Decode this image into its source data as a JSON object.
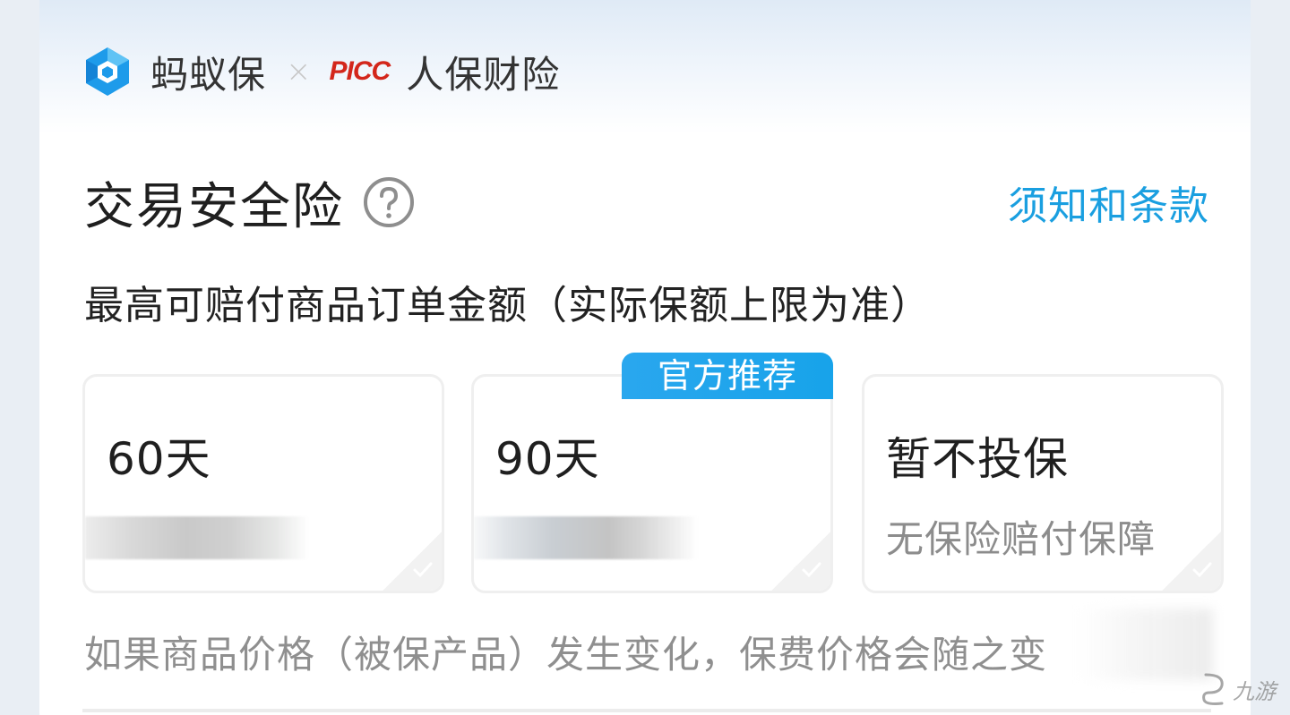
{
  "header": {
    "brand_name": "蚂蚁保",
    "separator": "×",
    "partner_logo_text": "PICC",
    "partner_name": "人保财险"
  },
  "product": {
    "title": "交易安全险",
    "terms_link": "须知和条款",
    "subtitle": "最高可赔付商品订单金额（实际保额上限为准）"
  },
  "options": [
    {
      "label": "60天",
      "desc": ""
    },
    {
      "label": "90天",
      "desc": "",
      "badge": "官方推荐"
    },
    {
      "label": "暂不投保",
      "desc": "无保险赔付保障"
    }
  ],
  "footer": {
    "note": "如果商品价格（被保产品）发生变化，保费价格会随之变"
  },
  "watermark": {
    "text": "九游"
  },
  "colors": {
    "accent": "#1a9fe0",
    "badge": "#17a3ea",
    "picc_red": "#d3261b"
  },
  "icons": {
    "brand": "ant-insurance-logo-icon",
    "help": "question-circle-icon",
    "check": "check-icon"
  }
}
